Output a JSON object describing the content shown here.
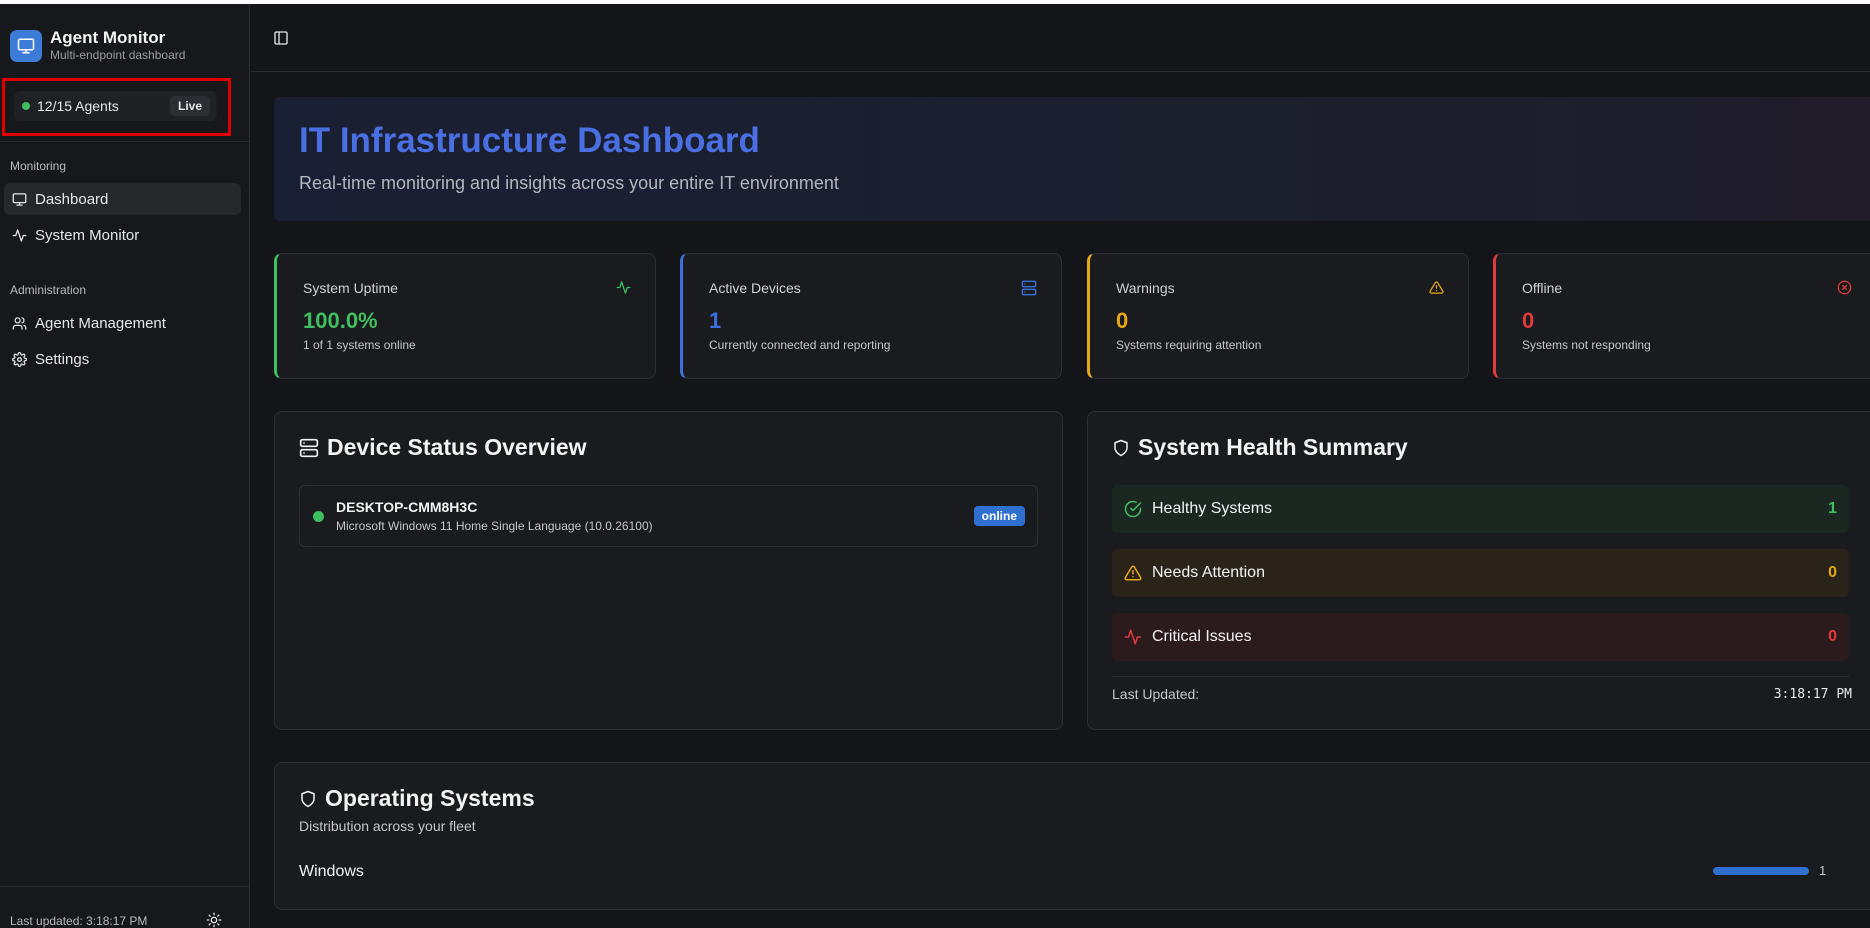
{
  "brand": {
    "title": "Agent Monitor",
    "subtitle": "Multi-endpoint dashboard"
  },
  "agents": {
    "status_text": "12/15 Agents",
    "live_label": "Live"
  },
  "sidebar": {
    "sections": [
      {
        "label": "Monitoring",
        "items": [
          {
            "label": "Dashboard",
            "icon": "monitor-icon",
            "active": true
          },
          {
            "label": "System Monitor",
            "icon": "activity-icon",
            "active": false
          }
        ]
      },
      {
        "label": "Administration",
        "items": [
          {
            "label": "Agent Management",
            "icon": "users-icon",
            "active": false
          },
          {
            "label": "Settings",
            "icon": "gear-icon",
            "active": false
          }
        ]
      }
    ],
    "footer": "Last updated: 3:18:17 PM"
  },
  "hero": {
    "title": "IT Infrastructure Dashboard",
    "subtitle": "Real-time monitoring and insights across your entire IT environment"
  },
  "stats": [
    {
      "label": "System Uptime",
      "value": "100.0%",
      "desc": "1 of 1 systems online",
      "color": "#3fbf5f",
      "icon": "activity-icon"
    },
    {
      "label": "Active Devices",
      "value": "1",
      "desc": "Currently connected and reporting",
      "color": "#3d6fe0",
      "icon": "server-icon"
    },
    {
      "label": "Warnings",
      "value": "0",
      "desc": "Systems requiring attention",
      "color": "#e6a817",
      "icon": "warning-icon"
    },
    {
      "label": "Offline",
      "value": "0",
      "desc": "Systems not responding",
      "color": "#e03a3a",
      "icon": "x-circle-icon"
    }
  ],
  "device_panel": {
    "title": "Device Status Overview",
    "devices": [
      {
        "name": "DESKTOP-CMM8H3C",
        "os": "Microsoft Windows 11 Home Single Language (10.0.26100)",
        "status": "online"
      }
    ]
  },
  "health_panel": {
    "title": "System Health Summary",
    "rows": [
      {
        "label": "Healthy Systems",
        "count": "1",
        "color": "#3fbf5f"
      },
      {
        "label": "Needs Attention",
        "count": "0",
        "color": "#e6a817"
      },
      {
        "label": "Critical Issues",
        "count": "0",
        "color": "#e03a3a"
      }
    ],
    "last_updated_label": "Last Updated:",
    "last_updated_time": "3:18:17 PM"
  },
  "os_panel": {
    "title": "Operating Systems",
    "subtitle": "Distribution across your fleet",
    "items": [
      {
        "name": "Windows",
        "count": "1",
        "fraction": 1.0
      }
    ]
  }
}
